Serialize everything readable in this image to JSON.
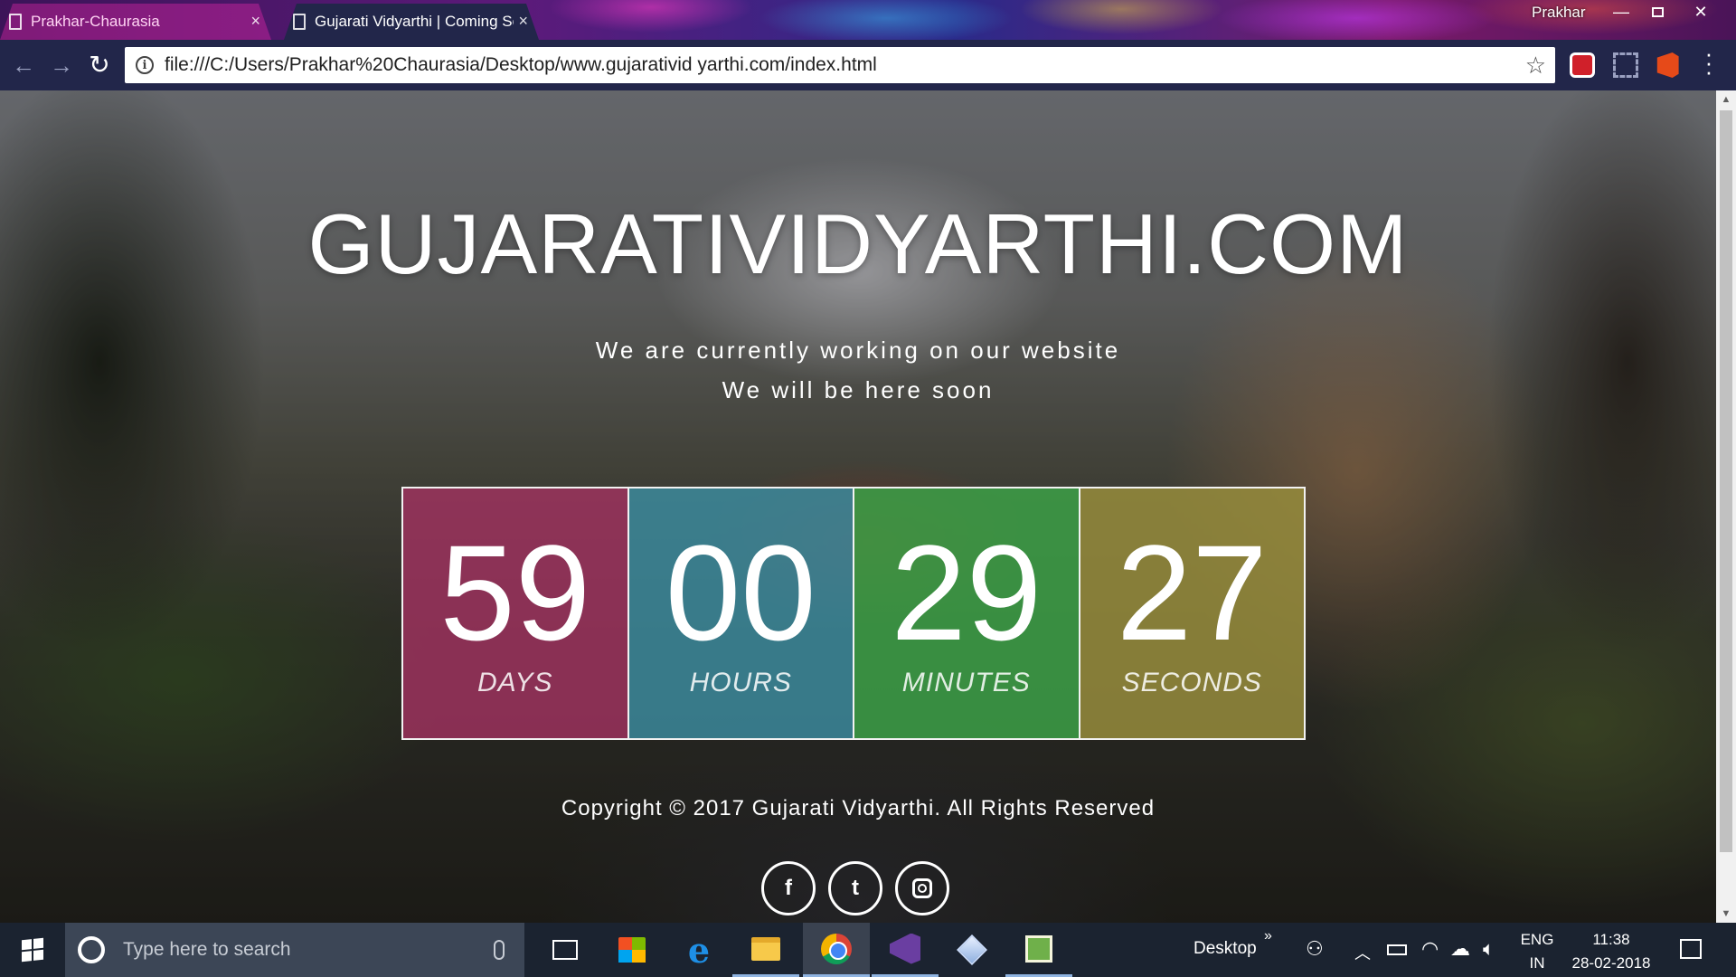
{
  "browser": {
    "tabs": [
      {
        "label": "Prakhar-Chaurasia",
        "active": false
      },
      {
        "label": "Gujarati Vidyarthi | Coming Soon",
        "active": true
      }
    ],
    "profile_name": "Prakhar",
    "url": "file:///C:/Users/Prakhar%20Chaurasia/Desktop/www.gujarativid yarthi.com/index.html"
  },
  "page": {
    "site_title": "GUJARATIVIDYARTHI.COM",
    "tagline_1": "We are currently working on our website",
    "tagline_2": "We will be here soon",
    "countdown": {
      "days": {
        "value": "59",
        "label": "DAYS",
        "color": "#a0325f"
      },
      "hours": {
        "value": "00",
        "label": "HOURS",
        "color": "#3c8ca0"
      },
      "minutes": {
        "value": "29",
        "label": "MINUTES",
        "color": "#3ca046"
      },
      "seconds": {
        "value": "27",
        "label": "SECONDS",
        "color": "#968c3c"
      }
    },
    "copyright": "Copyright © 2017 Gujarati Vidyarthi. All Rights Reserved",
    "socials": [
      {
        "name": "facebook",
        "glyph": "f"
      },
      {
        "name": "twitter",
        "glyph": "t"
      },
      {
        "name": "instagram",
        "glyph": ""
      }
    ]
  },
  "taskbar": {
    "search_placeholder": "Type here to search",
    "desktop_label": "Desktop",
    "chevron": "»",
    "language_line_1": "ENG",
    "language_line_2": "IN",
    "time": "11:38",
    "date": "28-02-2018",
    "apps": [
      "task-view",
      "store",
      "edge",
      "file-explorer",
      "chrome",
      "visual-studio",
      "3d-viewer",
      "spreadsheet"
    ]
  }
}
